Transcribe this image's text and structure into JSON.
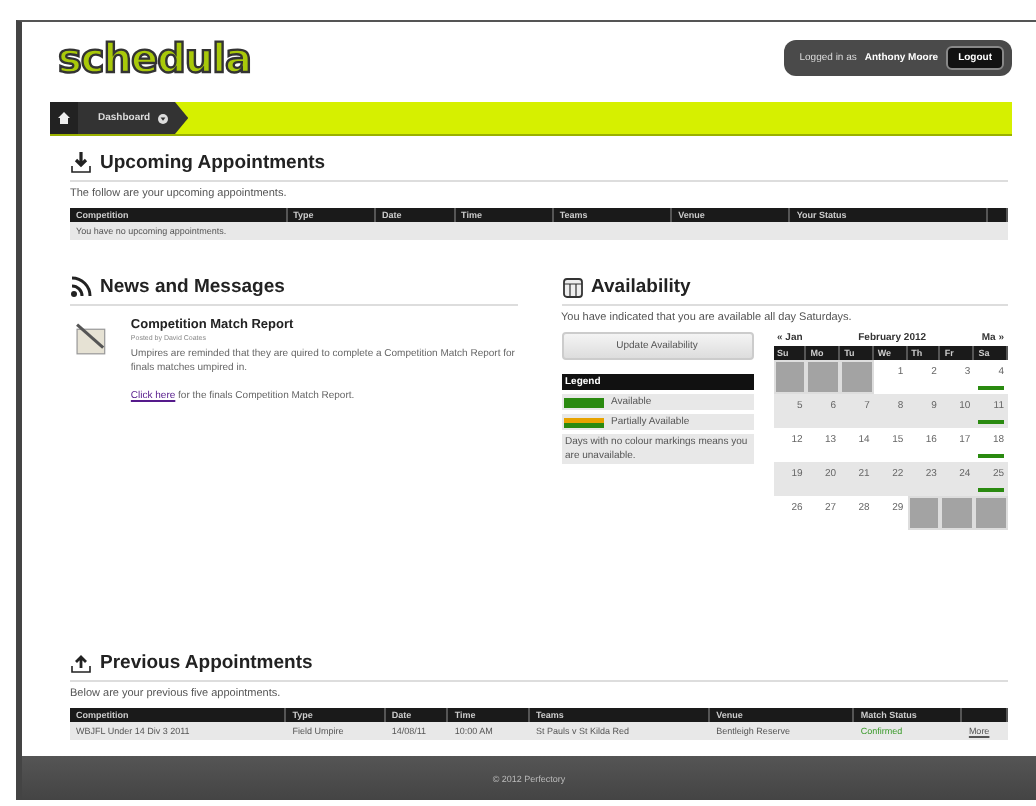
{
  "header": {
    "logo": "schedula",
    "login_text": "Logged in as",
    "user": "Anthony Moore",
    "logout": "Logout"
  },
  "nav": {
    "crumb": "Dashboard"
  },
  "upcoming": {
    "title": "Upcoming Appointments",
    "intro": "The follow are your upcoming appointments.",
    "columns": [
      "Competition",
      "Type",
      "Date",
      "Time",
      "Teams",
      "Venue",
      "Your Status"
    ],
    "empty": "You have no upcoming appointments."
  },
  "news": {
    "title": "News and Messages",
    "items": [
      {
        "title": "Competition Match Report",
        "byline": "Posted by David Coates",
        "body": "Umpires are reminded that they are quired to complete a Competition Match Report for finals matches umpired in.",
        "link": "Click here",
        "link_tail": "for the finals Competition Match Report."
      }
    ]
  },
  "availability": {
    "title": "Availability",
    "intro": "You have indicated that you are available all day Saturdays.",
    "button": "Update Availability",
    "legend": {
      "title": "Legend",
      "items": [
        {
          "label": "Available",
          "kind": "full"
        },
        {
          "label": "Partially Available",
          "kind": "partial"
        }
      ],
      "note": "Days with no colour markings means you are unavailable."
    },
    "calendar": {
      "prev": "« Jan",
      "month": "February 2012",
      "next": "Ma »",
      "weekdays": [
        "Su",
        "Mo",
        "Tu",
        "We",
        "Th",
        "Fr",
        "Sa"
      ],
      "weeks": [
        [
          {
            "kind": "blank"
          },
          {
            "kind": "blank"
          },
          {
            "kind": "blank"
          },
          {
            "kind": "day",
            "day": "1",
            "available": false
          },
          {
            "kind": "day",
            "day": "2",
            "available": false
          },
          {
            "kind": "day",
            "day": "3",
            "available": false
          },
          {
            "kind": "day",
            "day": "4",
            "available": true
          }
        ],
        [
          {
            "kind": "day",
            "day": "5",
            "available": false
          },
          {
            "kind": "day",
            "day": "6",
            "available": false
          },
          {
            "kind": "day",
            "day": "7",
            "available": false
          },
          {
            "kind": "day",
            "day": "8",
            "available": false
          },
          {
            "kind": "day",
            "day": "9",
            "available": false
          },
          {
            "kind": "day",
            "day": "10",
            "available": false
          },
          {
            "kind": "day",
            "day": "11",
            "available": true
          }
        ],
        [
          {
            "kind": "day",
            "day": "12",
            "available": false
          },
          {
            "kind": "day",
            "day": "13",
            "available": false
          },
          {
            "kind": "day",
            "day": "14",
            "available": false
          },
          {
            "kind": "day",
            "day": "15",
            "available": false
          },
          {
            "kind": "day",
            "day": "16",
            "available": false
          },
          {
            "kind": "day",
            "day": "17",
            "available": false
          },
          {
            "kind": "day",
            "day": "18",
            "available": true
          }
        ],
        [
          {
            "kind": "day",
            "day": "19",
            "available": false
          },
          {
            "kind": "day",
            "day": "20",
            "available": false
          },
          {
            "kind": "day",
            "day": "21",
            "available": false
          },
          {
            "kind": "day",
            "day": "22",
            "available": false
          },
          {
            "kind": "day",
            "day": "23",
            "available": false
          },
          {
            "kind": "day",
            "day": "24",
            "available": false
          },
          {
            "kind": "day",
            "day": "25",
            "available": true
          }
        ],
        [
          {
            "kind": "day",
            "day": "26",
            "available": false
          },
          {
            "kind": "day",
            "day": "27",
            "available": false
          },
          {
            "kind": "day",
            "day": "28",
            "available": false
          },
          {
            "kind": "day",
            "day": "29",
            "available": false
          },
          {
            "kind": "blank"
          },
          {
            "kind": "blank"
          },
          {
            "kind": "blank"
          }
        ]
      ]
    }
  },
  "previous": {
    "title": "Previous Appointments",
    "intro": "Below are your previous five appointments.",
    "columns": [
      "Competition",
      "Type",
      "Date",
      "Time",
      "Teams",
      "Venue",
      "Match Status"
    ],
    "rows": [
      {
        "cells": [
          "WBJFL Under 14 Div 3 2011",
          "Field Umpire",
          "14/08/11",
          "10:00 AM",
          "St Pauls v St Kilda Red",
          "Bentleigh Reserve",
          "Confirmed"
        ],
        "confirmed": true,
        "action": "More"
      }
    ]
  },
  "footer": "© 2012 Perfectory"
}
